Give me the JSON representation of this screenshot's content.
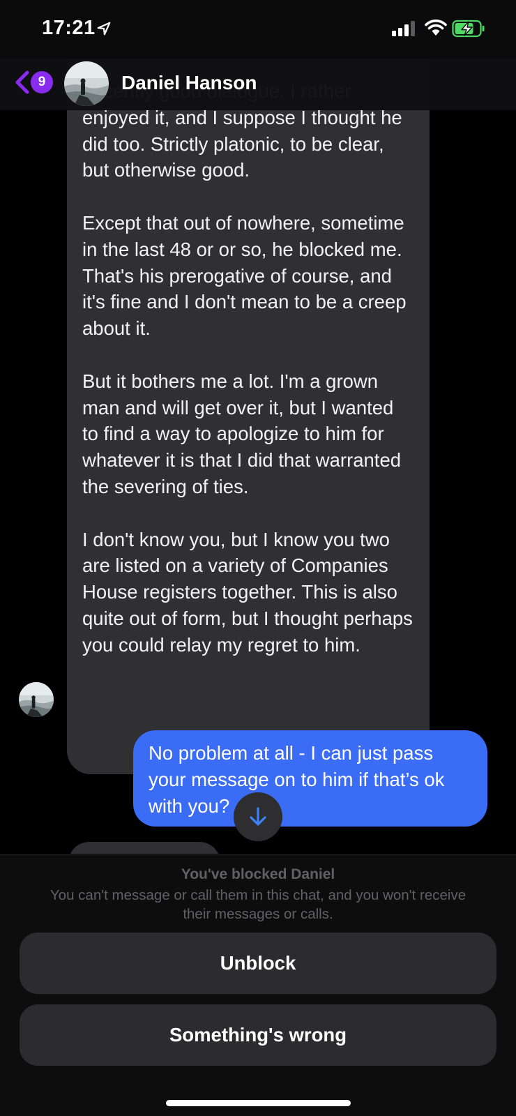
{
  "status_bar": {
    "time": "17:21",
    "icons": [
      "location-arrow-icon",
      "cell-signal-icon",
      "wifi-icon",
      "battery-charging-icon"
    ]
  },
  "header": {
    "unread_count": "9",
    "contact_name": "Daniel Hanson"
  },
  "messages": {
    "incoming": [
      "decently good dialogue. I rather enjoyed it, and I suppose I thought he did too. Strictly platonic, to be clear, but otherwise good.",
      "Except that out of nowhere, sometime in the last 48 or or so, he blocked me. That's his prerogative of course, and it's fine and I don't mean to be a creep about it.",
      "But it bothers me a lot. I'm a grown man and will get over it, but I wanted to find a way to apologize to him for whatever it is that I did that warranted the severing of ties.",
      "I don't know you, but I know you two are listed on a variety of Companies House registers together. This is also quite out of form, but I thought perhaps you could relay my regret to him."
    ],
    "outgoing": "No problem at all - I can just pass your message on to him if that’s ok with you?"
  },
  "blocked": {
    "title": "You've blocked Daniel",
    "subtitle": "You can't message or call them in this chat, and you won't receive their messages or calls.",
    "unblock_label": "Unblock",
    "wrong_label": "Something's wrong"
  },
  "colors": {
    "outgoing_bubble": "#3b6cf6",
    "incoming_bubble": "#303032",
    "badge": "#8a2bf0",
    "battery_green": "#4cd964"
  }
}
